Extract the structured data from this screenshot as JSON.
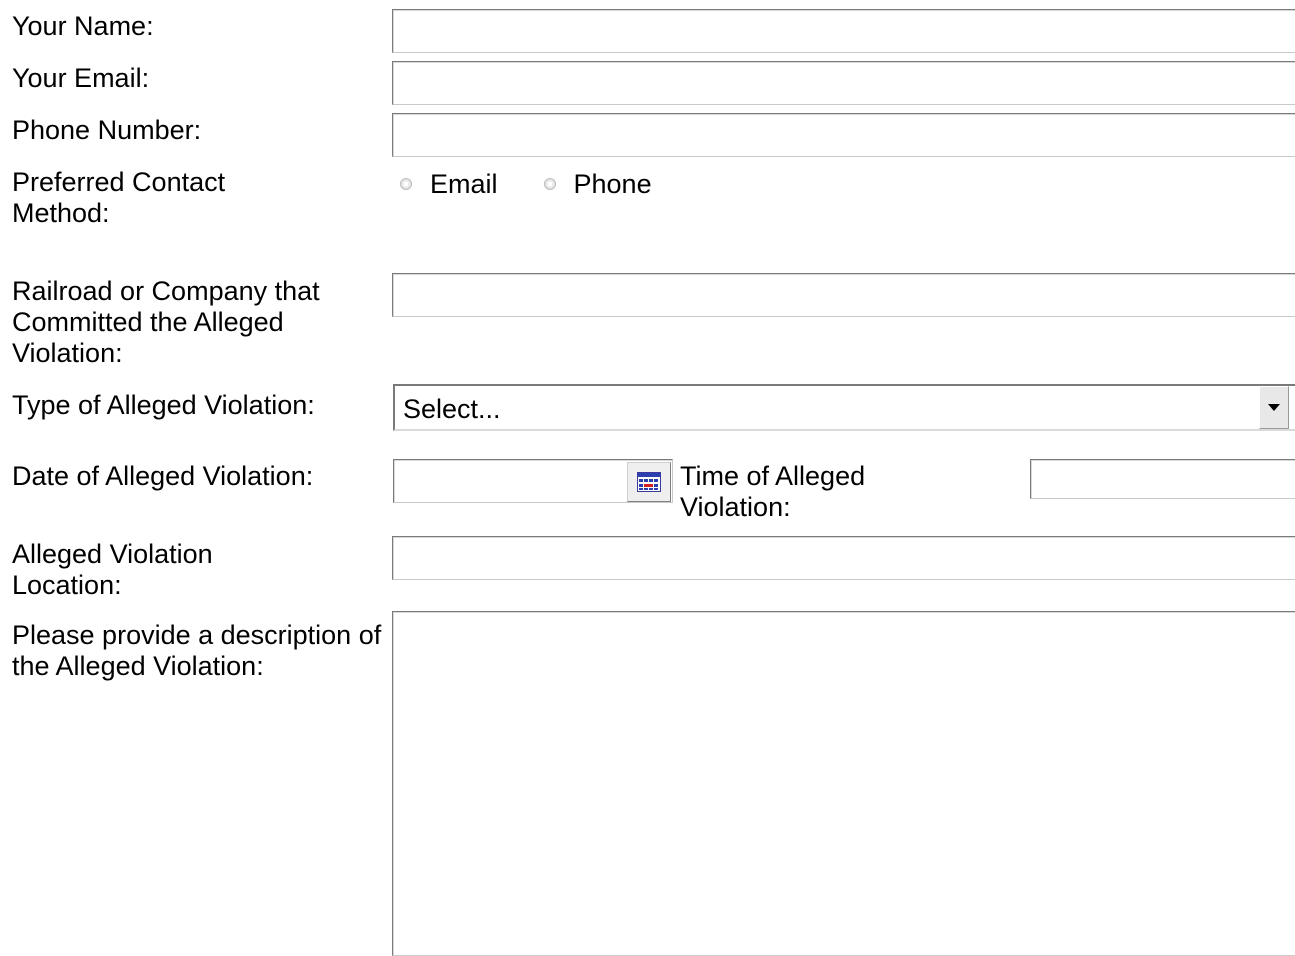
{
  "form": {
    "name": {
      "label": "Your Name:",
      "value": ""
    },
    "email": {
      "label": "Your Email:",
      "value": ""
    },
    "phone": {
      "label": "Phone Number:",
      "value": ""
    },
    "contact_method": {
      "label": "Preferred Contact Method:",
      "options": [
        "Email",
        "Phone"
      ],
      "selected": null
    },
    "company": {
      "label": "Railroad or Company that Committed the Alleged Violation:",
      "value": ""
    },
    "violation_type": {
      "label": "Type of Alleged Violation:",
      "selected": "Select..."
    },
    "date": {
      "label": "Date of Alleged Violation:",
      "value": "",
      "icon": "calendar-icon"
    },
    "time": {
      "label": "Time of Alleged Violation:",
      "value": ""
    },
    "location": {
      "label": "Alleged Violation Location:",
      "value": ""
    },
    "description": {
      "label": "Please provide a description of the Alleged Violation:",
      "value": ""
    }
  }
}
